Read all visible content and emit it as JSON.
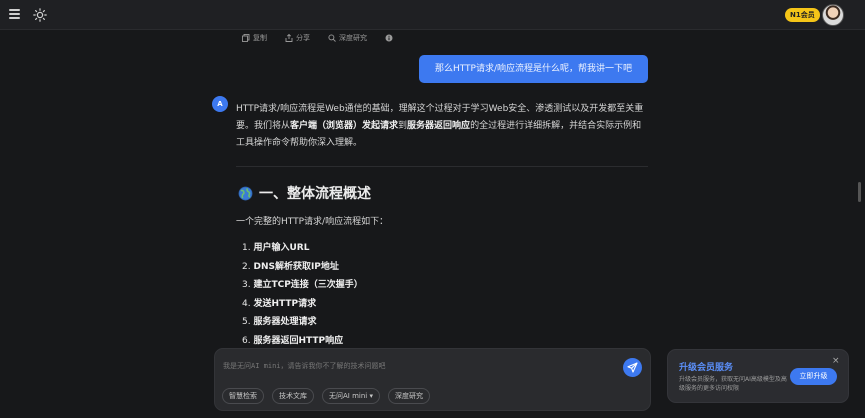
{
  "topbar": {
    "vip_label": "N1会员"
  },
  "actions": [
    {
      "label": "复制",
      "icon": "copy-icon"
    },
    {
      "label": "分享",
      "icon": "share-icon"
    },
    {
      "label": "深度研究",
      "icon": "research-icon"
    }
  ],
  "user_message": "那么HTTP请求/响应流程是什么呢，帮我讲一下吧",
  "ai": {
    "avatar_letter": "A",
    "paragraph": {
      "p1": "HTTP请求/响应流程是Web通信的基础，理解这个过程对于学习Web安全、渗透测试以及开发都至关重要。我们将从",
      "b1": "客户端（浏览器）发起请求",
      "p2": "到",
      "b2": "服务器返回响应",
      "p3": "的全过程进行详细拆解，并结合实际示例和工具操作命令帮助你深入理解。"
    },
    "section_title": "一、整体流程概述",
    "intro": "一个完整的HTTP请求/响应流程如下：",
    "steps": [
      {
        "num": "1.",
        "text": "用户输入URL"
      },
      {
        "num": "2.",
        "text": "DNS解析获取IP地址"
      },
      {
        "num": "3.",
        "text": "建立TCP连接（三次握手）"
      },
      {
        "num": "4.",
        "text": "发送HTTP请求"
      },
      {
        "num": "5.",
        "text": "服务器处理请求"
      },
      {
        "num": "6.",
        "text": "服务器返回HTTP响应"
      }
    ]
  },
  "input": {
    "placeholder": "我是无问AI mini，请告诉我你不了解的技术问题吧",
    "chips": [
      "智慧检索",
      "技术文库",
      "无问AI mini ▾",
      "深度研究"
    ]
  },
  "upgrade": {
    "title": "升级会员服务",
    "description": "升级会员服务，获取无问AI高级模型及高级服务的更多访问权限",
    "button": "立即升级",
    "close": "×"
  },
  "colors": {
    "accent": "#3d79f0",
    "vip": "#f5c518",
    "background": "#17181a"
  }
}
